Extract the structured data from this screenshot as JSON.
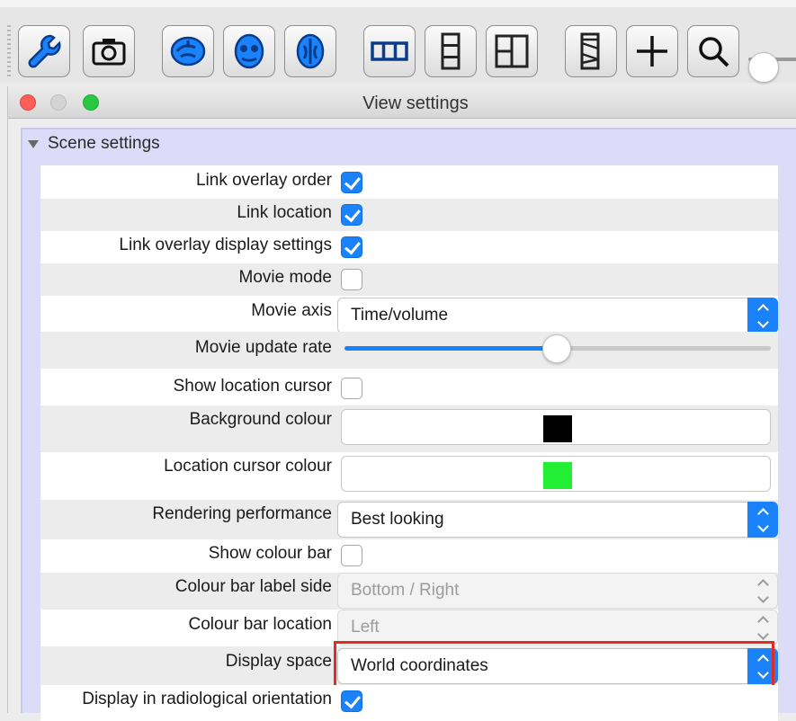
{
  "toolbar": {
    "buttons": [
      {
        "name": "wrench-icon"
      },
      {
        "name": "camera-icon"
      },
      {
        "name": "brain-lateral-icon"
      },
      {
        "name": "brain-axial-icon"
      },
      {
        "name": "brain-coronal-icon"
      },
      {
        "name": "layout-horizontal-icon"
      },
      {
        "name": "layout-vertical-icon"
      },
      {
        "name": "layout-grid-icon"
      },
      {
        "name": "movie-icon"
      },
      {
        "name": "crosshair-icon"
      },
      {
        "name": "zoom-icon"
      }
    ]
  },
  "window": {
    "title": "View settings"
  },
  "group": {
    "label": "Scene settings"
  },
  "settings": {
    "link_overlay_order": {
      "label": "Link overlay order",
      "checked": true
    },
    "link_location": {
      "label": "Link location",
      "checked": true
    },
    "link_overlay_display": {
      "label": "Link overlay display settings",
      "checked": true
    },
    "movie_mode": {
      "label": "Movie mode",
      "checked": false
    },
    "movie_axis": {
      "label": "Movie axis",
      "value": "Time/volume"
    },
    "movie_update_rate": {
      "label": "Movie update rate",
      "fraction": 0.49
    },
    "show_location_cursor": {
      "label": "Show location cursor",
      "checked": false
    },
    "background_colour": {
      "label": "Background colour",
      "color": "#000000"
    },
    "location_cursor_colour": {
      "label": "Location cursor colour",
      "color": "#22ee33"
    },
    "rendering_performance": {
      "label": "Rendering performance",
      "value": "Best looking"
    },
    "show_colour_bar": {
      "label": "Show colour bar",
      "checked": false
    },
    "colour_bar_label_side": {
      "label": "Colour bar label side",
      "value": "Bottom / Right"
    },
    "colour_bar_location": {
      "label": "Colour bar location",
      "value": "Left"
    },
    "display_space": {
      "label": "Display space",
      "value": "World coordinates"
    },
    "radiological": {
      "label": "Display in radiological orientation",
      "checked": true
    }
  },
  "colors": {
    "accent": "#1a82fb",
    "highlight": "#e32b26"
  }
}
